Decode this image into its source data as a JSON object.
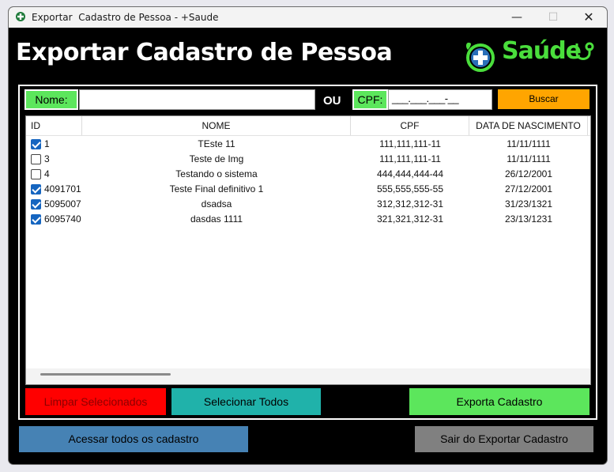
{
  "window": {
    "title": "Exportar  Cadastro de Pessoa - +Saude",
    "controls": {
      "minimize": "—",
      "maximize": "☐",
      "close": "✕"
    }
  },
  "header": {
    "title": "Exportar Cadastro de Pessoa",
    "logo_text": "Saúde"
  },
  "search": {
    "name_label": "Nome:",
    "name_value": "",
    "or_label": "OU",
    "cpf_label": "CPF:",
    "cpf_value": "___.___.___-__",
    "search_button": "Buscar"
  },
  "table": {
    "columns": [
      "ID",
      "NOME",
      "CPF",
      "DATA DE NASCIMENTO"
    ],
    "rows": [
      {
        "checked": true,
        "id": "1",
        "nome": "TEste 11",
        "cpf": "111,111,111-11",
        "nascimento": "11/11/1111"
      },
      {
        "checked": false,
        "id": "3",
        "nome": "Teste de Img",
        "cpf": "111,111,111-11",
        "nascimento": "11/11/1111"
      },
      {
        "checked": false,
        "id": "4",
        "nome": "Testando o sistema",
        "cpf": "444,444,444-44",
        "nascimento": "26/12/2001"
      },
      {
        "checked": true,
        "id": "4091701",
        "nome": "Teste Final definitivo 1",
        "cpf": "555,555,555-55",
        "nascimento": "27/12/2001"
      },
      {
        "checked": true,
        "id": "5095007",
        "nome": "dsadsa",
        "cpf": "312,312,312-31",
        "nascimento": "31/23/1321"
      },
      {
        "checked": true,
        "id": "6095740",
        "nome": "dasdas 1111",
        "cpf": "321,321,312-31",
        "nascimento": "23/13/1231"
      }
    ]
  },
  "actions": {
    "clear_selected": "Limpar Selecionados",
    "select_all": "Selecionar Todos",
    "export": "Exporta Cadastro",
    "access_all": "Acessar todos os cadastro",
    "exit": "Sair do Exportar Cadastro"
  },
  "colors": {
    "accent_green": "#5ce65c",
    "orange": "#ffa500",
    "red": "#ff0000",
    "teal": "#20b2aa",
    "steel_blue": "#4682b4",
    "gray": "#808080"
  }
}
